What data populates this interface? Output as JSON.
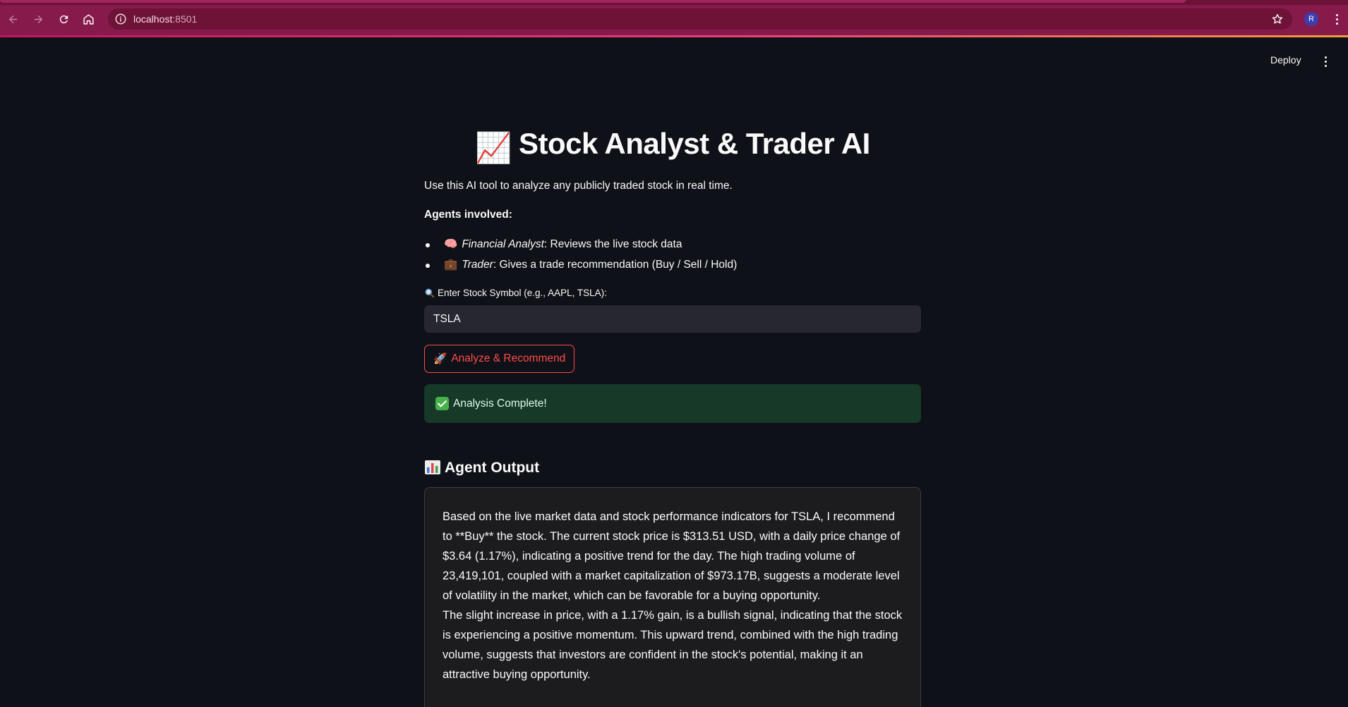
{
  "browser": {
    "url_host": "localhost",
    "url_port": ":8501",
    "profile_initial": "R"
  },
  "header": {
    "deploy_label": "Deploy"
  },
  "page": {
    "title_emoji": "📈",
    "title": "Stock Analyst & Trader AI",
    "intro": "Use this AI tool to analyze any publicly traded stock in real time.",
    "agents_heading": "Agents involved:",
    "agents": [
      {
        "icon": "🧠",
        "name": "Financial Analyst",
        "desc": ": Reviews the live stock data"
      },
      {
        "icon": "💼",
        "name": "Trader",
        "desc": ": Gives a trade recommendation (Buy / Sell / Hold)"
      }
    ],
    "input_label": "Enter Stock Symbol (e.g., AAPL, TSLA):",
    "input_value": "TSLA",
    "button_icon": "🚀",
    "button_label": "Analyze & Recommend",
    "success_text": "Analysis Complete!",
    "output_heading": "Agent Output",
    "output_paragraphs": [
      "Based on the live market data and stock performance indicators for TSLA, I recommend to **Buy** the stock. The current stock price is $313.51 USD, with a daily price change of $3.64 (1.17%), indicating a positive trend for the day. The high trading volume of 23,419,101, coupled with a market capitalization of $973.17B, suggests a moderate level of volatility in the market, which can be favorable for a buying opportunity.",
      "The slight increase in price, with a 1.17% gain, is a bullish signal, indicating that the stock is experiencing a positive momentum. This upward trend, combined with the high trading volume, suggests that investors are confident in the stock's potential, making it an attractive buying opportunity."
    ]
  },
  "colors": {
    "chrome": "#861b4b",
    "background": "#0e1117",
    "accent": "#ff4b4b",
    "success_bg": "#173928"
  },
  "icons": [
    "back-arrow-icon",
    "forward-arrow-icon",
    "reload-icon",
    "home-icon",
    "info-icon",
    "star-icon",
    "magnifier-icon",
    "check-icon",
    "bar-chart-icon"
  ]
}
